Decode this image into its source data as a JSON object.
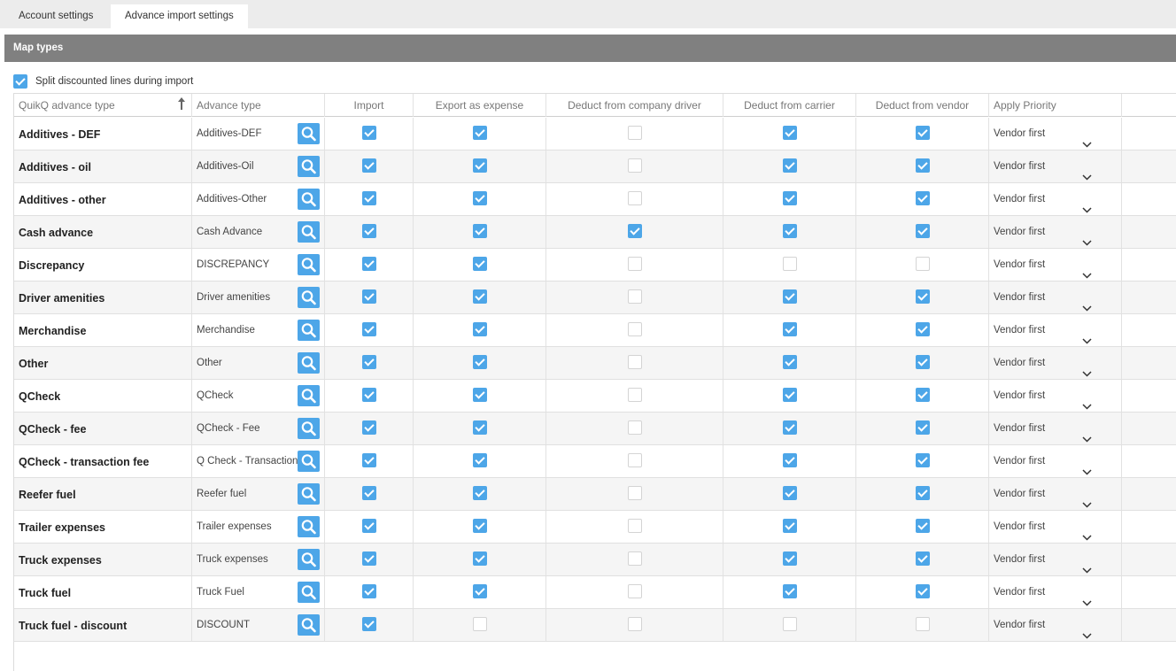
{
  "tabs": [
    {
      "label": "Account settings",
      "active": false
    },
    {
      "label": "Advance import settings",
      "active": true
    }
  ],
  "section_title": "Map types",
  "split_option": {
    "label": "Split discounted lines during import",
    "checked": true
  },
  "columns": [
    "QuikQ advance type",
    "Advance type",
    "Import",
    "Export as expense",
    "Deduct from company driver",
    "Deduct from carrier",
    "Deduct from vendor",
    "Apply Priority"
  ],
  "rows": [
    {
      "quik": "Additives - DEF",
      "advance": "Additives-DEF",
      "import": true,
      "export": true,
      "company_driver": false,
      "carrier": true,
      "vendor": true,
      "priority": "Vendor first"
    },
    {
      "quik": "Additives - oil",
      "advance": "Additives-Oil",
      "import": true,
      "export": true,
      "company_driver": false,
      "carrier": true,
      "vendor": true,
      "priority": "Vendor first"
    },
    {
      "quik": "Additives - other",
      "advance": "Additives-Other",
      "import": true,
      "export": true,
      "company_driver": false,
      "carrier": true,
      "vendor": true,
      "priority": "Vendor first"
    },
    {
      "quik": "Cash advance",
      "advance": "Cash Advance",
      "import": true,
      "export": true,
      "company_driver": true,
      "carrier": true,
      "vendor": true,
      "priority": "Vendor first"
    },
    {
      "quik": "Discrepancy",
      "advance": "DISCREPANCY",
      "import": true,
      "export": true,
      "company_driver": false,
      "carrier": false,
      "vendor": false,
      "priority": "Vendor first"
    },
    {
      "quik": "Driver amenities",
      "advance": "Driver amenities",
      "import": true,
      "export": true,
      "company_driver": false,
      "carrier": true,
      "vendor": true,
      "priority": "Vendor first"
    },
    {
      "quik": "Merchandise",
      "advance": "Merchandise",
      "import": true,
      "export": true,
      "company_driver": false,
      "carrier": true,
      "vendor": true,
      "priority": "Vendor first"
    },
    {
      "quik": "Other",
      "advance": "Other",
      "import": true,
      "export": true,
      "company_driver": false,
      "carrier": true,
      "vendor": true,
      "priority": "Vendor first"
    },
    {
      "quik": "QCheck",
      "advance": "QCheck",
      "import": true,
      "export": true,
      "company_driver": false,
      "carrier": true,
      "vendor": true,
      "priority": "Vendor first"
    },
    {
      "quik": "QCheck - fee",
      "advance": "QCheck - Fee",
      "import": true,
      "export": true,
      "company_driver": false,
      "carrier": true,
      "vendor": true,
      "priority": "Vendor first"
    },
    {
      "quik": "QCheck - transaction fee",
      "advance": "Q Check - Transaction Fee",
      "import": true,
      "export": true,
      "company_driver": false,
      "carrier": true,
      "vendor": true,
      "priority": "Vendor first"
    },
    {
      "quik": "Reefer fuel",
      "advance": "Reefer fuel",
      "import": true,
      "export": true,
      "company_driver": false,
      "carrier": true,
      "vendor": true,
      "priority": "Vendor first"
    },
    {
      "quik": "Trailer expenses",
      "advance": "Trailer expenses",
      "import": true,
      "export": true,
      "company_driver": false,
      "carrier": true,
      "vendor": true,
      "priority": "Vendor first"
    },
    {
      "quik": "Truck expenses",
      "advance": "Truck expenses",
      "import": true,
      "export": true,
      "company_driver": false,
      "carrier": true,
      "vendor": true,
      "priority": "Vendor first"
    },
    {
      "quik": "Truck fuel",
      "advance": "Truck Fuel",
      "import": true,
      "export": true,
      "company_driver": false,
      "carrier": true,
      "vendor": true,
      "priority": "Vendor first"
    },
    {
      "quik": "Truck fuel - discount",
      "advance": "DISCOUNT",
      "import": true,
      "export": false,
      "company_driver": false,
      "carrier": false,
      "vendor": false,
      "priority": "Vendor first"
    }
  ],
  "colors": {
    "accent": "#4da6e8",
    "section_bar": "#808080",
    "tab_bar": "#ececec"
  }
}
